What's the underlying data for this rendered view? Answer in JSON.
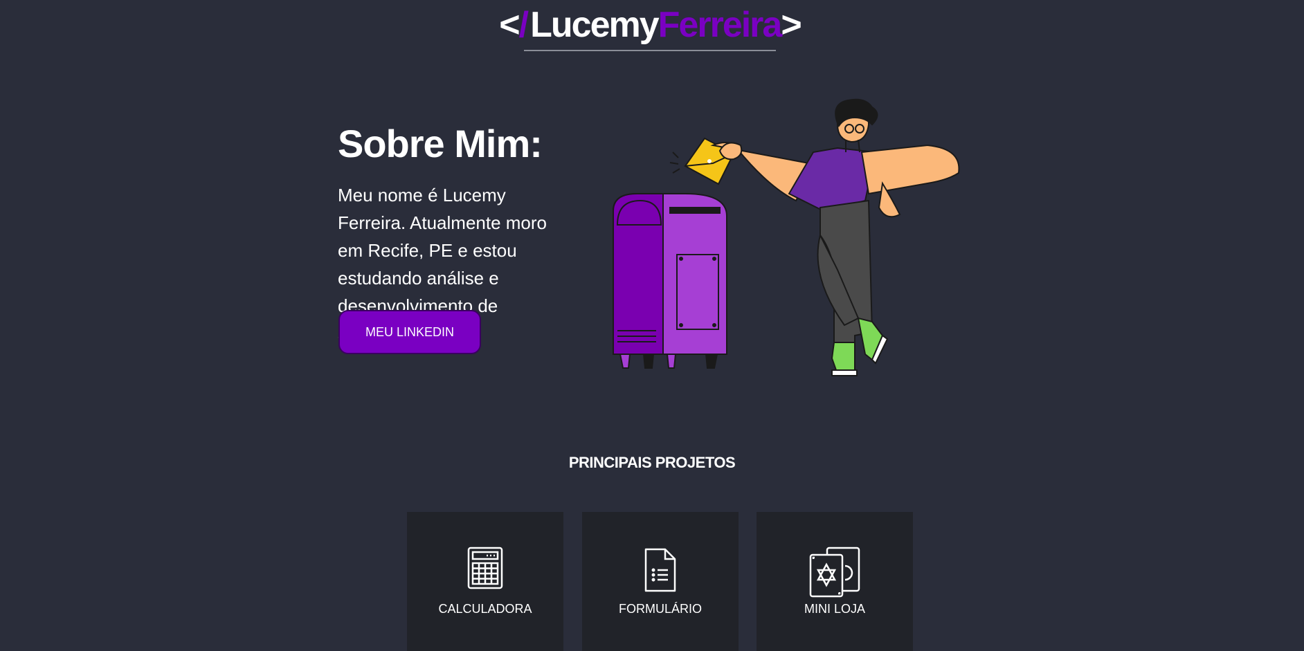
{
  "header": {
    "logo_open": "<",
    "logo_slash": "/",
    "logo_first": "Lucemy",
    "logo_last": "Ferreira",
    "logo_close": ">"
  },
  "about": {
    "title": "Sobre Mim:",
    "text": "Meu nome é Lucemy Ferreira. Atualmente moro em Recife, PE e estou estudando análise e desenvolvimento de sistemas.",
    "button_label": "MEU LINKEDIN"
  },
  "projects": {
    "title": "PRINCIPAIS PROJETOS",
    "items": [
      {
        "label": "CALCULADORA",
        "icon": "calculator-icon"
      },
      {
        "label": "FORMULÁRIO",
        "icon": "document-icon"
      },
      {
        "label": "MINI LOJA",
        "icon": "cards-icon"
      }
    ]
  },
  "colors": {
    "background": "#2a2d3a",
    "accent": "#7a00c2",
    "card_background": "#212329"
  }
}
